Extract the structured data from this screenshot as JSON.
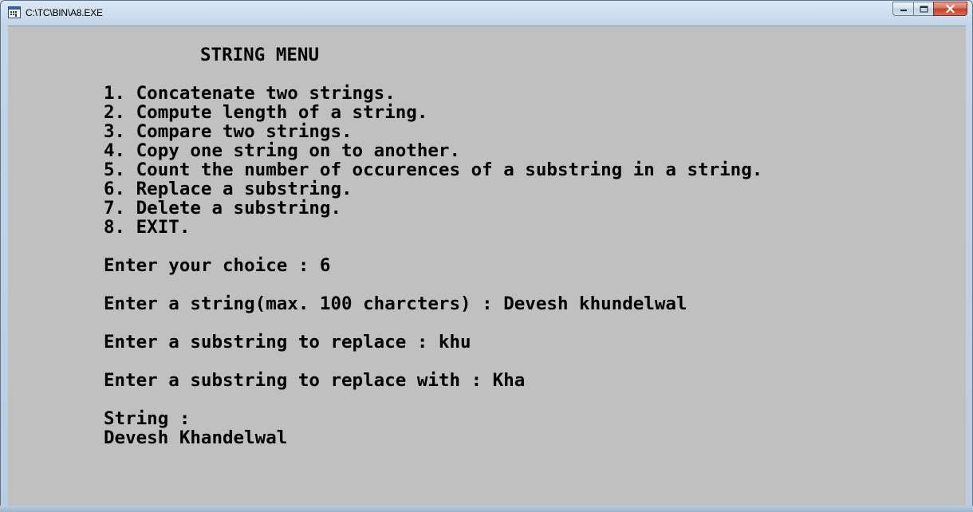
{
  "window": {
    "title": "C:\\TC\\BIN\\A8.EXE",
    "app_icon": "dos-program-icon",
    "buttons": {
      "minimize_icon": "minimize-icon",
      "maximize_icon": "maximize-icon",
      "close_icon": "close-icon"
    },
    "colors": {
      "console_background": "#c0c0c0",
      "console_text": "#000000",
      "close_button": "#c8452f"
    }
  },
  "console": {
    "menu_title": "STRING MENU",
    "menu_items": [
      "1. Concatenate two strings.",
      "2. Compute length of a string.",
      "3. Compare two strings.",
      "4. Copy one string on to another.",
      "5. Count the number of occurences of a substring in a string.",
      "6. Replace a substring.",
      "7. Delete a substring.",
      "8. EXIT."
    ],
    "choice_prompt": "Enter your choice : 6",
    "string_prompt": "Enter a string(max. 100 charcters) : Devesh khundelwal",
    "substring_prompt": "Enter a substring to replace : khu",
    "replacement_prompt": "Enter a substring to replace with : Kha",
    "result_label": "String :",
    "result_value": "Devesh Khandelwal"
  }
}
